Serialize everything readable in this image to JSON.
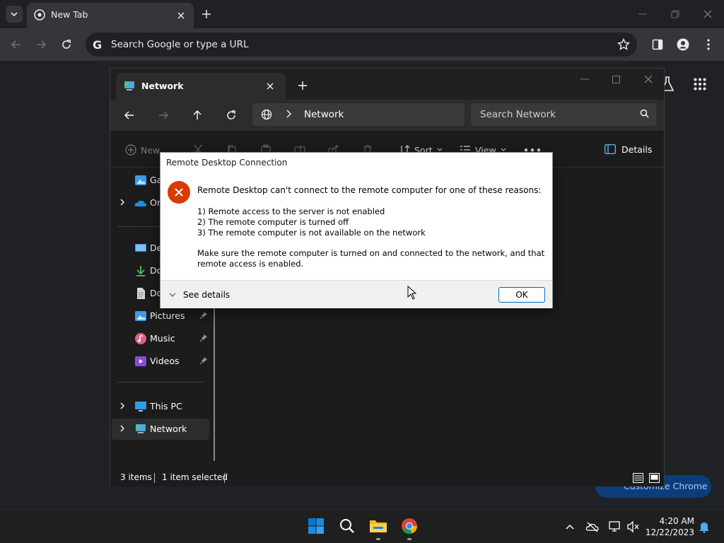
{
  "chrome": {
    "tab_title": "New Tab",
    "omnibox_placeholder": "Search Google or type a URL",
    "omnibox_logo": "G",
    "customize_label": "Customize Chrome"
  },
  "explorer": {
    "tab_title": "Network",
    "address_text": "Network",
    "search_placeholder": "Search Network",
    "commands": {
      "new": "New",
      "sort": "Sort",
      "view": "View",
      "more": "•••",
      "details": "Details"
    },
    "sidebar": {
      "gallery": "Ga",
      "onedrive": "Or",
      "desktop": "De",
      "downloads": "Do",
      "documents": "Do",
      "pictures": "Pictures",
      "music": "Music",
      "videos": "Videos",
      "this_pc": "This PC",
      "network": "Network"
    },
    "status": {
      "items": "3 items",
      "selected": "1 item selected"
    }
  },
  "dialog": {
    "title": "Remote Desktop Connection",
    "main_message": "Remote Desktop can't connect to the remote computer for one of these reasons:",
    "reasons": [
      "1) Remote access to the server is not enabled",
      "2) The remote computer is turned off",
      "3) The remote computer is not available on the network"
    ],
    "advice": "Make sure the remote computer is turned on and connected to the network, and that remote access is enabled.",
    "see_details": "See details",
    "ok_label": "OK"
  },
  "taskbar": {
    "time": "4:20 AM",
    "date": "12/22/2023"
  },
  "colors": {
    "error": "#d83b01",
    "accent": "#0067c0",
    "windows_blue": "#0078d4"
  }
}
